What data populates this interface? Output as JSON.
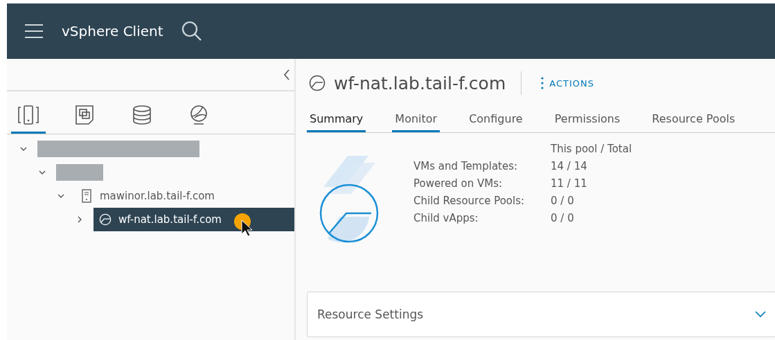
{
  "header": {
    "title": "vSphere Client"
  },
  "navigator": {
    "views": [
      {
        "kind": "hosts",
        "selected": true
      },
      {
        "kind": "vms",
        "selected": false
      },
      {
        "kind": "storage",
        "selected": false
      },
      {
        "kind": "network",
        "selected": false
      }
    ],
    "tree": [
      {
        "kind": "redacted",
        "expanded": true,
        "children": [
          {
            "kind": "redacted",
            "expanded": true,
            "children": [
              {
                "kind": "host",
                "label": "mawinor.lab.tail-f.com",
                "expanded": true,
                "selected": false,
                "children": [
                  {
                    "kind": "pool",
                    "label": "wf-nat.lab.tail-f.com",
                    "expanded": false,
                    "selected": true
                  }
                ]
              }
            ]
          }
        ]
      }
    ]
  },
  "object": {
    "title": "wf-nat.lab.tail-f.com",
    "actions": "ACTIONS"
  },
  "tabs": [
    {
      "label": "Summary",
      "selected": true,
      "underlined": true
    },
    {
      "label": "Monitor",
      "selected": false,
      "underlined": true
    },
    {
      "label": "Configure",
      "selected": false,
      "underlined": false
    },
    {
      "label": "Permissions",
      "selected": false,
      "underlined": false
    },
    {
      "label": "Resource Pools",
      "selected": false,
      "underlined": false
    }
  ],
  "summary": {
    "column_heading": "This pool / Total",
    "rows": [
      {
        "label": "VMs and Templates:",
        "value": "14 / 14"
      },
      {
        "label": "Powered on VMs:",
        "value": "11 / 11"
      },
      {
        "label": "Child Resource Pools:",
        "value": "0 / 0"
      },
      {
        "label": "Child vApps:",
        "value": "0 / 0"
      }
    ]
  },
  "resource_settings": {
    "title": "Resource Settings",
    "expanded": false
  }
}
